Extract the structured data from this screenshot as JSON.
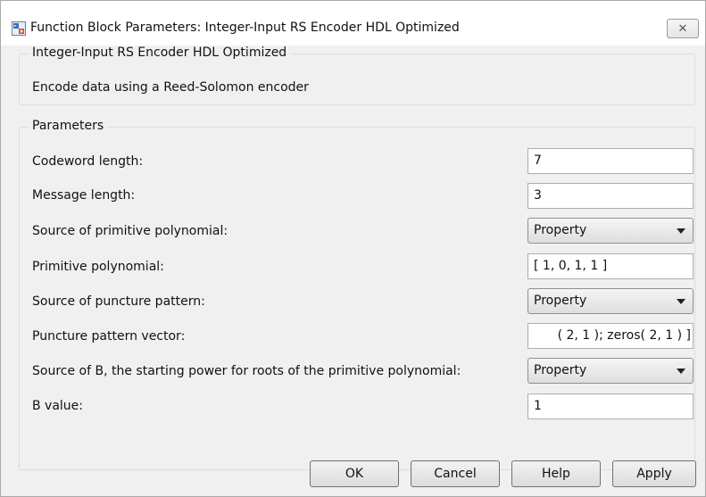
{
  "window": {
    "title": "Function Block Parameters: Integer-Input RS Encoder HDL Optimized"
  },
  "block": {
    "name": "Integer-Input RS Encoder HDL Optimized",
    "description": "Encode data using a Reed-Solomon encoder"
  },
  "parameters": {
    "group_label": "Parameters",
    "codeword_length": {
      "label": "Codeword length:",
      "value": "7"
    },
    "message_length": {
      "label": "Message length:",
      "value": "3"
    },
    "primitive_poly_source": {
      "label": "Source of primitive polynomial:",
      "value": "Property"
    },
    "primitive_poly": {
      "label": "Primitive polynomial:",
      "value": "[ 1, 0, 1, 1 ]"
    },
    "puncture_source": {
      "label": "Source of puncture pattern:",
      "value": "Property"
    },
    "puncture_vector": {
      "label": "Puncture pattern vector:",
      "value": "( 2, 1 ); zeros( 2, 1 ) ]"
    },
    "b_source": {
      "label": "Source of B, the starting power for roots of the primitive polynomial:",
      "value": "Property"
    },
    "b_value": {
      "label": "B value:",
      "value": "1"
    }
  },
  "buttons": {
    "ok": "OK",
    "cancel": "Cancel",
    "help": "Help",
    "apply": "Apply"
  }
}
